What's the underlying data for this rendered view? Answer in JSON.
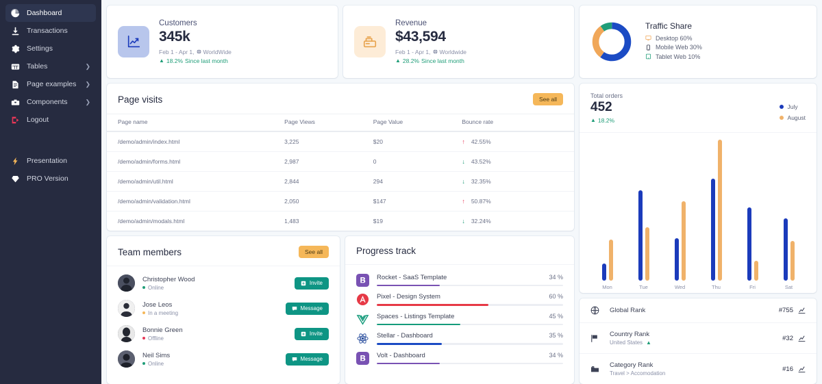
{
  "sidebar": {
    "items": [
      {
        "label": "Dashboard",
        "icon": "pie-chart-icon",
        "active": true,
        "chevron": false
      },
      {
        "label": "Transactions",
        "icon": "download-icon",
        "active": false,
        "chevron": false
      },
      {
        "label": "Settings",
        "icon": "gear-icon",
        "active": false,
        "chevron": false
      },
      {
        "label": "Tables",
        "icon": "table-icon",
        "active": false,
        "chevron": true
      },
      {
        "label": "Page examples",
        "icon": "document-icon",
        "active": false,
        "chevron": true
      },
      {
        "label": "Components",
        "icon": "toolbox-icon",
        "active": false,
        "chevron": true
      },
      {
        "label": "Logout",
        "icon": "logout-icon",
        "active": false,
        "chevron": false
      }
    ],
    "footer_items": [
      {
        "label": "Presentation",
        "icon": "bolt-icon"
      },
      {
        "label": "PRO Version",
        "icon": "diamond-icon"
      }
    ]
  },
  "stats": [
    {
      "title": "Customers",
      "value": "345k",
      "range": "Feb 1 - Apr 1,",
      "scope": "WorldWide",
      "delta": "18.2%",
      "delta_suffix": "Since last month",
      "icon": "chart-up-icon",
      "icon_bg": "#b8c6ec"
    },
    {
      "title": "Revenue",
      "value": "$43,594",
      "range": "Feb 1 - Apr 1,",
      "scope": "Worldwide",
      "delta": "28.2%",
      "delta_suffix": "Since last month",
      "icon": "cash-register-icon",
      "icon_bg": "#fdecd7"
    }
  ],
  "traffic_share": {
    "title": "Traffic Share",
    "items": [
      {
        "label": "Desktop 60%",
        "icon": "desktop-icon",
        "color": "#1b4bc4",
        "value": 60
      },
      {
        "label": "Mobile Web 30%",
        "icon": "mobile-icon",
        "color": "#f0a759",
        "value": 30
      },
      {
        "label": "Tablet Web 10%",
        "icon": "tablet-icon",
        "color": "#1f9d78",
        "value": 10
      }
    ]
  },
  "page_visits": {
    "title": "Page visits",
    "see_all": "See all",
    "columns": [
      "Page name",
      "Page Views",
      "Page Value",
      "Bounce rate"
    ],
    "rows": [
      {
        "name": "/demo/admin/index.html",
        "views": "3,225",
        "value": "$20",
        "bounce": "42.55%",
        "dir": "up"
      },
      {
        "name": "/demo/admin/forms.html",
        "views": "2,987",
        "value": "0",
        "bounce": "43.52%",
        "dir": "down"
      },
      {
        "name": "/demo/admin/util.html",
        "views": "2,844",
        "value": "294",
        "bounce": "32.35%",
        "dir": "down"
      },
      {
        "name": "/demo/admin/validation.html",
        "views": "2,050",
        "value": "$147",
        "bounce": "50.87%",
        "dir": "up"
      },
      {
        "name": "/demo/admin/modals.html",
        "views": "1,483",
        "value": "$19",
        "bounce": "32.24%",
        "dir": "down"
      }
    ]
  },
  "team_members": {
    "title": "Team members",
    "see_all": "See all",
    "members": [
      {
        "name": "Christopher Wood",
        "status": "Online",
        "status_type": "online",
        "action": "Invite",
        "action_icon": "invite-icon"
      },
      {
        "name": "Jose Leos",
        "status": "In a meeting",
        "status_type": "meeting",
        "action": "Message",
        "action_icon": "message-icon"
      },
      {
        "name": "Bonnie Green",
        "status": "Offline",
        "status_type": "offline",
        "action": "Invite",
        "action_icon": "invite-icon"
      },
      {
        "name": "Neil Sims",
        "status": "Online",
        "status_type": "online",
        "action": "Message",
        "action_icon": "message-icon"
      }
    ]
  },
  "progress_track": {
    "title": "Progress track",
    "items": [
      {
        "label": "Rocket - SaaS Template",
        "pct": "34 %",
        "value": 34,
        "color": "#7952b3",
        "logo": "bootstrap-icon"
      },
      {
        "label": "Pixel - Design System",
        "pct": "60 %",
        "value": 60,
        "color": "#e63946",
        "logo": "angular-icon"
      },
      {
        "label": "Spaces - Listings Template",
        "pct": "45 %",
        "value": 45,
        "color": "#159b7b",
        "logo": "vue-icon"
      },
      {
        "label": "Stellar - Dashboard",
        "pct": "35 %",
        "value": 35,
        "color": "#1b4bc4",
        "logo": "react-icon"
      },
      {
        "label": "Volt - Dashboard",
        "pct": "34 %",
        "value": 34,
        "color": "#7952b3",
        "logo": "bootstrap-icon"
      }
    ]
  },
  "total_orders": {
    "title": "Total orders",
    "value": "452",
    "delta": "18.2%",
    "legend": [
      {
        "label": "July",
        "color": "#1b3bbb"
      },
      {
        "label": "August",
        "color": "#f0b26a"
      }
    ]
  },
  "chart_data": {
    "type": "bar",
    "title": "Total orders",
    "categories": [
      "Mon",
      "Tue",
      "Wed",
      "Thu",
      "Fri",
      "Sat"
    ],
    "series": [
      {
        "name": "July",
        "color": "#1b3bbb",
        "values": [
          12,
          64,
          30,
          72,
          52,
          44
        ]
      },
      {
        "name": "August",
        "color": "#f0b26a",
        "values": [
          29,
          38,
          56,
          100,
          14,
          28
        ]
      }
    ],
    "xlabel": "",
    "ylabel": "",
    "ylim": [
      0,
      100
    ],
    "grid": false,
    "legend_position": "top-right"
  },
  "rankings": [
    {
      "title": "Global Rank",
      "sub": "",
      "value": "#755",
      "icon": "globe-icon",
      "trend": "chart-icon"
    },
    {
      "title": "Country Rank",
      "sub": "United States",
      "sub_caret": "up",
      "value": "#32",
      "icon": "flag-icon",
      "trend": "chart-icon"
    },
    {
      "title": "Category Rank",
      "sub": "Travel > Accomodation",
      "value": "#16",
      "icon": "folder-icon",
      "trend": "chart-icon"
    }
  ]
}
